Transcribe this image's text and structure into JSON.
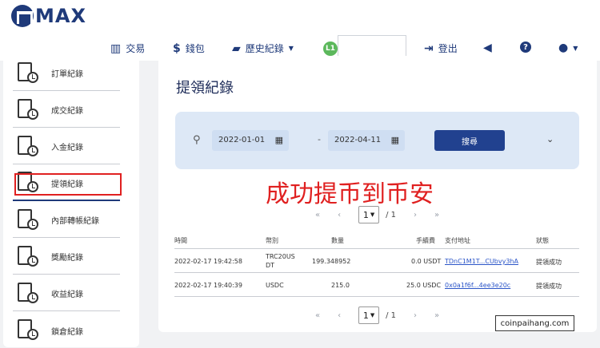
{
  "brand": {
    "logo_text": "MAX"
  },
  "nav": {
    "trade": "交易",
    "wallet": "錢包",
    "history": "歷史紀錄",
    "level": "L1",
    "logout": "登出"
  },
  "sidebar": {
    "items": [
      {
        "label": "訂單紀錄"
      },
      {
        "label": "成交紀錄"
      },
      {
        "label": "入金紀錄"
      },
      {
        "label": "提領紀錄"
      },
      {
        "label": "內部轉帳紀錄"
      },
      {
        "label": "獎勵紀錄"
      },
      {
        "label": "收益紀錄"
      },
      {
        "label": "鎖倉紀錄"
      }
    ]
  },
  "main": {
    "title": "提領紀錄",
    "filter": {
      "start_date": "2022-01-01",
      "end_date": "2022-04-11",
      "separator": "-",
      "search_label": "搜尋"
    },
    "annotation": "成功提币到币安",
    "pager": {
      "first": "«",
      "prev": "‹",
      "page": "1",
      "total": "/ 1",
      "next": "›",
      "last": "»"
    },
    "table": {
      "headers": [
        "時間",
        "幣別",
        "數量",
        "手續費",
        "支付地址",
        "狀態"
      ],
      "rows": [
        {
          "time": "2022-02-17 19:42:58",
          "currency": "TRC20US DT",
          "amount": "199.348952",
          "fee": "0.0 USDT",
          "address": "TDnC1M1T...CUbvy3hA",
          "status": "提領成功"
        },
        {
          "time": "2022-02-17 19:40:39",
          "currency": "USDC",
          "amount": "215.0",
          "fee": "25.0 USDC",
          "address": "0x0a1f6f...4ee3e20c",
          "status": "提領成功"
        }
      ]
    }
  },
  "watermark": "coinpaihang.com",
  "colors": {
    "brand": "#1f3a7a",
    "primary_button": "#21418f",
    "annotation": "#e02020",
    "link": "#2b55c8"
  }
}
